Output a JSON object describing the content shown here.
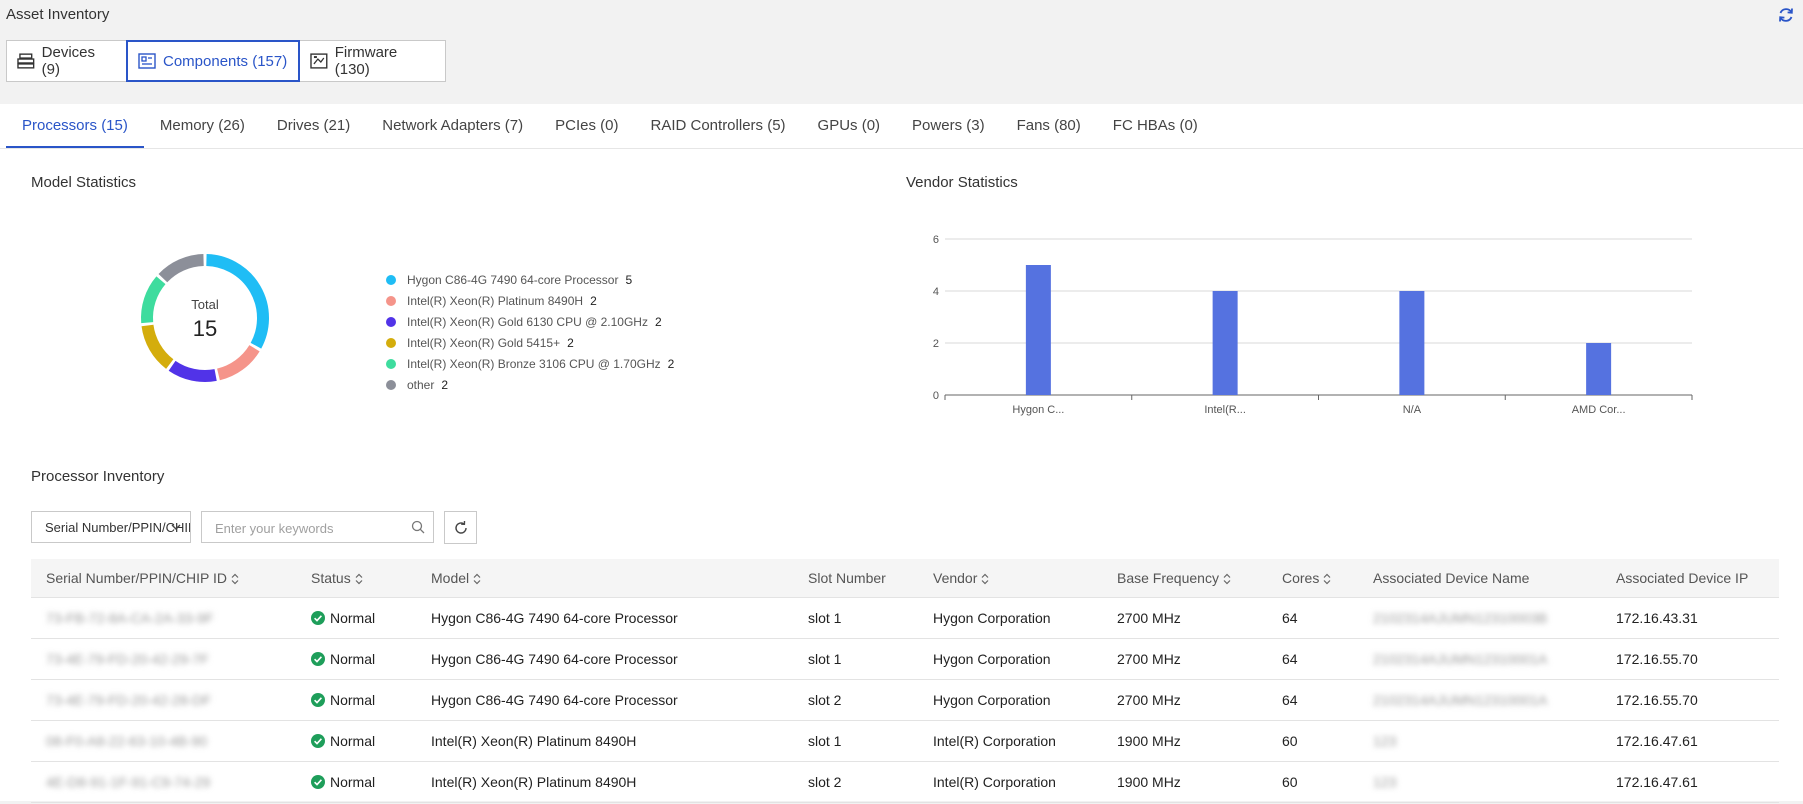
{
  "page": {
    "title": "Asset Inventory"
  },
  "type_tabs": [
    {
      "label": "Devices (9)",
      "icon": "devices-icon"
    },
    {
      "label": "Components (157)",
      "icon": "components-icon"
    },
    {
      "label": "Firmware (130)",
      "icon": "firmware-icon"
    }
  ],
  "sub_tabs": [
    "Processors (15)",
    "Memory (26)",
    "Drives (21)",
    "Network Adapters (7)",
    "PCIes (0)",
    "RAID Controllers (5)",
    "GPUs (0)",
    "Powers (3)",
    "Fans (80)",
    "FC HBAs (0)"
  ],
  "model_stats": {
    "title": "Model Statistics",
    "total_label": "Total",
    "total_value": "15",
    "legend": [
      {
        "label": "Hygon C86-4G 7490 64-core Processor",
        "value": "5",
        "color": "#1fbdf5"
      },
      {
        "label": "Intel(R) Xeon(R) Platinum 8490H",
        "value": "2",
        "color": "#f5948a"
      },
      {
        "label": "Intel(R) Xeon(R) Gold 6130 CPU @ 2.10GHz",
        "value": "2",
        "color": "#5133e8"
      },
      {
        "label": "Intel(R) Xeon(R) Gold 5415+",
        "value": "2",
        "color": "#d4ad0c"
      },
      {
        "label": "Intel(R) Xeon(R) Bronze 3106 CPU @ 1.70GHz",
        "value": "2",
        "color": "#3edc9e"
      },
      {
        "label": "other",
        "value": "2",
        "color": "#8c8f99"
      }
    ]
  },
  "vendor_stats": {
    "title": "Vendor Statistics"
  },
  "chart_data": {
    "type": "bar",
    "categories": [
      "Hygon C...",
      "Intel(R...",
      "N/A",
      "AMD Cor..."
    ],
    "values": [
      5,
      4,
      4,
      2
    ],
    "ylim": [
      0,
      6
    ],
    "yticks": [
      0,
      2,
      4,
      6
    ],
    "grid": true,
    "color": "#5572e0"
  },
  "inventory": {
    "title": "Processor Inventory",
    "field_select": "Serial Number/PPIN/CHIP ID",
    "search_placeholder": "Enter your keywords",
    "columns": [
      {
        "label": "Serial Number/PPIN/CHIP ID",
        "sortable": true
      },
      {
        "label": "Status",
        "sortable": true
      },
      {
        "label": "Model",
        "sortable": true
      },
      {
        "label": "Slot Number",
        "sortable": false
      },
      {
        "label": "Vendor",
        "sortable": true
      },
      {
        "label": "Base Frequency",
        "sortable": true
      },
      {
        "label": "Cores",
        "sortable": true
      },
      {
        "label": "Associated Device Name",
        "sortable": false
      },
      {
        "label": "Associated Device IP",
        "sortable": false
      }
    ],
    "rows": [
      {
        "serial": "73-FB-72-8A-CA-2A-33-9F",
        "status": "Normal",
        "model": "Hygon C86-4G 7490 64-core Processor",
        "slot": "slot 1",
        "vendor": "Hygon Corporation",
        "freq": "2700 MHz",
        "cores": "64",
        "device": "2102314AJUMN12310003B",
        "ip": "172.16.43.31"
      },
      {
        "serial": "73-4E-79-FD-20-42-29-7F",
        "status": "Normal",
        "model": "Hygon C86-4G 7490 64-core Processor",
        "slot": "slot 1",
        "vendor": "Hygon Corporation",
        "freq": "2700 MHz",
        "cores": "64",
        "device": "2102314AJUMN12310001A",
        "ip": "172.16.55.70"
      },
      {
        "serial": "73-4E-79-FD-20-42-28-DF",
        "status": "Normal",
        "model": "Hygon C86-4G 7490 64-core Processor",
        "slot": "slot 2",
        "vendor": "Hygon Corporation",
        "freq": "2700 MHz",
        "cores": "64",
        "device": "2102314AJUMN12310001A",
        "ip": "172.16.55.70"
      },
      {
        "serial": "08-F0-A8-22-63-10-4B-90",
        "status": "Normal",
        "model": "Intel(R) Xeon(R) Platinum 8490H",
        "slot": "slot 1",
        "vendor": "Intel(R) Corporation",
        "freq": "1900 MHz",
        "cores": "60",
        "device": "123",
        "ip": "172.16.47.61"
      },
      {
        "serial": "4E-D8-91-1F-91-C9-74-29",
        "status": "Normal",
        "model": "Intel(R) Xeon(R) Platinum 8490H",
        "slot": "slot 2",
        "vendor": "Intel(R) Corporation",
        "freq": "1900 MHz",
        "cores": "60",
        "device": "123",
        "ip": "172.16.47.61"
      }
    ]
  }
}
